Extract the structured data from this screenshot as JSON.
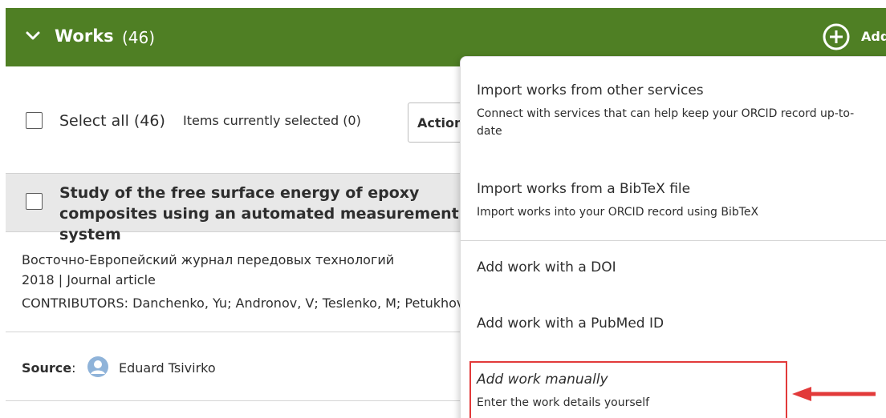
{
  "header": {
    "title": "Works",
    "count": "(46)",
    "add_label": "Add"
  },
  "selection": {
    "select_all_label": "Select all (46)",
    "items_selected": "Items currently selected (0)",
    "actions_label": "Actions"
  },
  "work": {
    "title": "Study of the free surface energy of epoxy composites using an automated measurement system",
    "journal": "Восточно-Европейский журнал передовых технологий",
    "year_type": "2018 | Journal article",
    "contributors": "CONTRIBUTORS: Danchenko, Yu; Andronov, V; Teslenko, M; Petukhova, O",
    "source_label": "Source",
    "source_name": "Eduard Tsivirko"
  },
  "add_menu": {
    "items": [
      {
        "title": "Import works from other services",
        "description": "Connect with services that can help keep your ORCID record up-to-date"
      },
      {
        "title": "Import works from a BibTeX file",
        "description": "Import works into your ORCID record using BibTeX"
      },
      {
        "title": "Add work with a DOI"
      },
      {
        "title": "Add work with a PubMed ID"
      },
      {
        "title": "Add work manually",
        "description": "Enter the work details yourself"
      }
    ]
  },
  "colors": {
    "header_green": "#4f7f24",
    "highlight_red": "#e23a3a",
    "avatar_blue": "#8fb3d9"
  },
  "icons": {
    "collapse": "chevron-down-icon",
    "add": "plus-circle-icon",
    "avatar": "user-avatar-icon",
    "annotation": "red-arrow-icon"
  }
}
